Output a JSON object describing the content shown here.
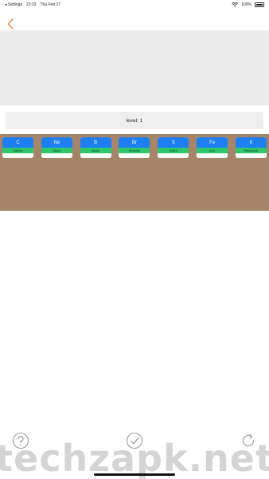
{
  "status_bar": {
    "back_app": "◂ Settings",
    "time": "23:33",
    "date": "Thu Feb 27",
    "battery": "100%"
  },
  "level": {
    "label": "level: 1"
  },
  "elements": [
    {
      "symbol": "C",
      "name": "Carbon"
    },
    {
      "symbol": "Ne",
      "name": "Neon"
    },
    {
      "symbol": "B",
      "name": "Boron"
    },
    {
      "symbol": "Br",
      "name": "Bromine"
    },
    {
      "symbol": "S",
      "name": "Sulfur"
    },
    {
      "symbol": "Fe",
      "name": "Iron"
    },
    {
      "symbol": "K",
      "name": "Potassium"
    }
  ],
  "toolbar": {
    "help_icon": "question-icon",
    "check_icon": "checkmark-icon",
    "refresh_icon": "refresh-icon"
  },
  "watermark": "techzapk.net",
  "colors": {
    "accent_back": "#e8823a",
    "symbol_bg": "#1e7ff3",
    "name_bg": "#2fc76b",
    "board_bg": "#a58468",
    "banner_bg": "#ececec"
  }
}
